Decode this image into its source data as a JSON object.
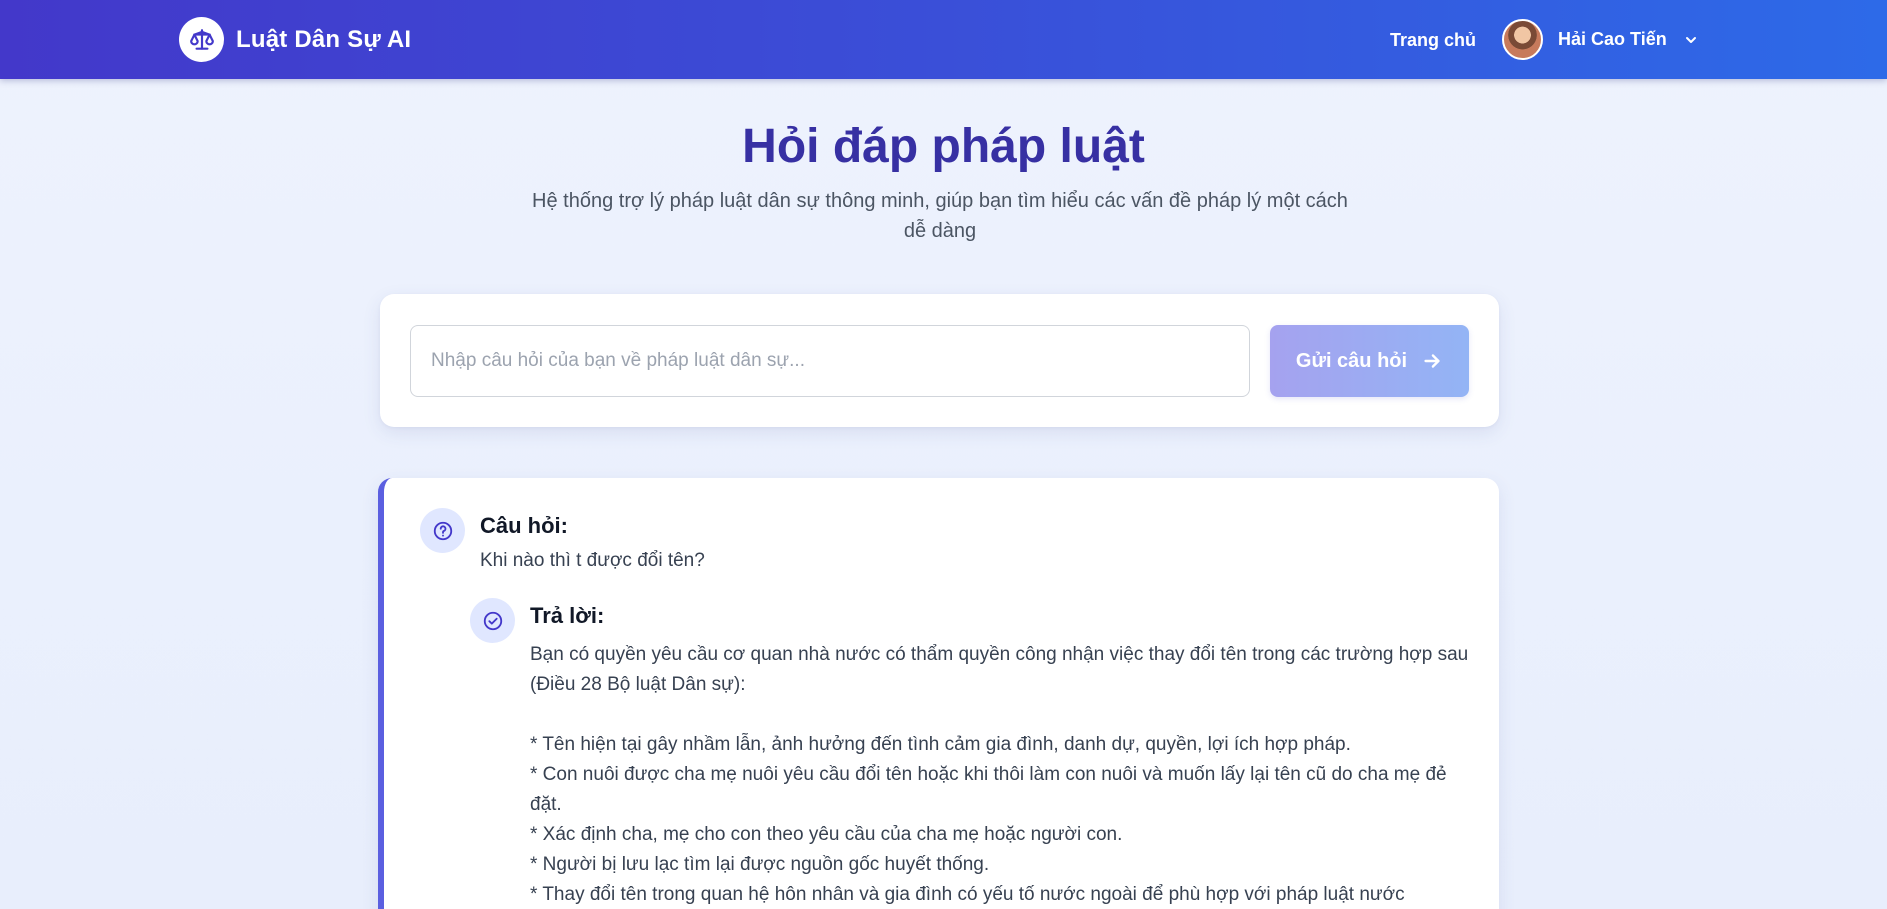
{
  "header": {
    "brand_name": "Luật Dân Sự AI",
    "logo_icon": "scales-icon",
    "nav_home": "Trang chủ",
    "user_name": "Hải Cao Tiến"
  },
  "hero": {
    "title": "Hỏi đáp pháp luật",
    "subtitle": "Hệ thống trợ lý pháp luật dân sự thông minh, giúp bạn tìm hiểu các vấn đề pháp lý một cách dễ dàng"
  },
  "ask": {
    "placeholder": "Nhập câu hỏi của bạn về pháp luật dân sự...",
    "value": "",
    "submit_label": "Gửi câu hỏi"
  },
  "qa": {
    "question_label": "Câu hỏi:",
    "question_text": "Khi nào thì t được đổi tên?",
    "answer_label": "Trả lời:",
    "answer_lines": [
      "Bạn có quyền yêu cầu cơ quan nhà nước có thẩm quyền công nhận việc thay đổi tên trong các trường hợp sau (Điều 28 Bộ luật Dân sự):",
      "",
      "* Tên hiện tại gây nhầm lẫn, ảnh hưởng đến tình cảm gia đình, danh dự, quyền, lợi ích hợp pháp.",
      "* Con nuôi được cha mẹ nuôi yêu cầu đổi tên hoặc khi thôi làm con nuôi và muốn lấy lại tên cũ do cha mẹ đẻ đặt.",
      "* Xác định cha, mẹ cho con theo yêu cầu của cha mẹ hoặc người con.",
      "* Người bị lưu lạc tìm lại được nguồn gốc huyết thống.",
      "* Thay đổi tên trong quan hệ hôn nhân và gia đình có yếu tố nước ngoài để phù hợp với pháp luật nước"
    ]
  },
  "colors": {
    "header_start": "#4338ca",
    "header_end": "#2d6ae8",
    "title": "#3730a3",
    "accent": "#5b5fe0"
  }
}
